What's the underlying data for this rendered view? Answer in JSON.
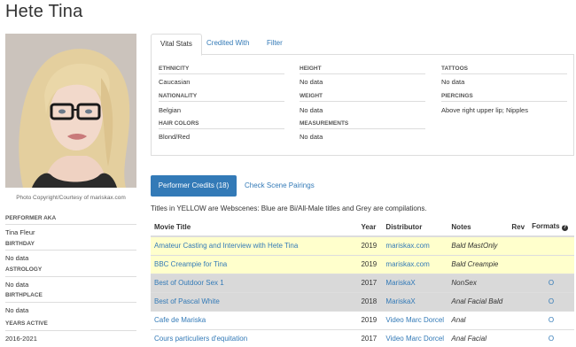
{
  "page": {
    "title": "Hete Tina"
  },
  "photo": {
    "caption": "Photo Copyright/Courtesy of mariskax.com"
  },
  "sidebar": {
    "fields": [
      {
        "label": "PERFORMER AKA",
        "value": "Tina Fleur"
      },
      {
        "label": "BIRTHDAY",
        "value": "No data"
      },
      {
        "label": "ASTROLOGY",
        "value": "No data"
      },
      {
        "label": "BIRTHPLACE",
        "value": "No data"
      },
      {
        "label": "YEARS ACTIVE",
        "value": "2016-2021"
      }
    ]
  },
  "tabs": [
    "Vital Stats",
    "Credited With",
    "Filter"
  ],
  "vital_stats": {
    "ethnicity": {
      "label": "ETHNICITY",
      "value": "Caucasian"
    },
    "nationality": {
      "label": "NATIONALITY",
      "value": "Belgian"
    },
    "hair_colors": {
      "label": "HAIR COLORS",
      "value": "Blond/Red"
    },
    "height": {
      "label": "HEIGHT",
      "value": "No data"
    },
    "weight": {
      "label": "WEIGHT",
      "value": "No data"
    },
    "measurements": {
      "label": "MEASUREMENTS",
      "value": "No data"
    },
    "tattoos": {
      "label": "TATTOOS",
      "value": "No data"
    },
    "piercings": {
      "label": "PIERCINGS",
      "value": "Above right upper lip; Nipples"
    }
  },
  "credits_button": "Performer Credits (18)",
  "pairings_link": "Check Scene Pairings",
  "legend": "Titles in YELLOW are Webscenes: Blue are Bi/All-Male titles and Grey are compilations.",
  "table": {
    "headers": {
      "title": "Movie Title",
      "year": "Year",
      "distributor": "Distributor",
      "notes": "Notes",
      "rev": "Rev",
      "formats": "Formats"
    },
    "rows": [
      {
        "title": "Amateur Casting and Interview with Hete Tina",
        "year": "2019",
        "distributor": "mariskax.com",
        "notes": "Bald MastOnly",
        "rev": "",
        "format": "",
        "style": "yellow"
      },
      {
        "title": "BBC Creampie for Tina",
        "year": "2019",
        "distributor": "mariskax.com",
        "notes": "Bald Creampie",
        "rev": "",
        "format": "",
        "style": "yellow"
      },
      {
        "title": "Best of Outdoor Sex 1",
        "year": "2017",
        "distributor": "MariskaX",
        "notes": "NonSex",
        "rev": "",
        "format": "O",
        "style": "grey"
      },
      {
        "title": "Best of Pascal White",
        "year": "2018",
        "distributor": "MariskaX",
        "notes": "Anal Facial Bald",
        "rev": "",
        "format": "O",
        "style": "grey"
      },
      {
        "title": "Cafe de Mariska",
        "year": "2019",
        "distributor": "Video Marc Dorcel",
        "notes": "Anal",
        "rev": "",
        "format": "O",
        "style": "white"
      },
      {
        "title": "Cours particuliers d'equitation",
        "year": "2017",
        "distributor": "Video Marc Dorcel",
        "notes": "Anal Facial",
        "rev": "",
        "format": "O",
        "style": "white"
      }
    ]
  },
  "colors": {
    "accent": "#337ab7",
    "webscene_row": "#ffffcc",
    "compilation_row": "#d9d9d9"
  }
}
